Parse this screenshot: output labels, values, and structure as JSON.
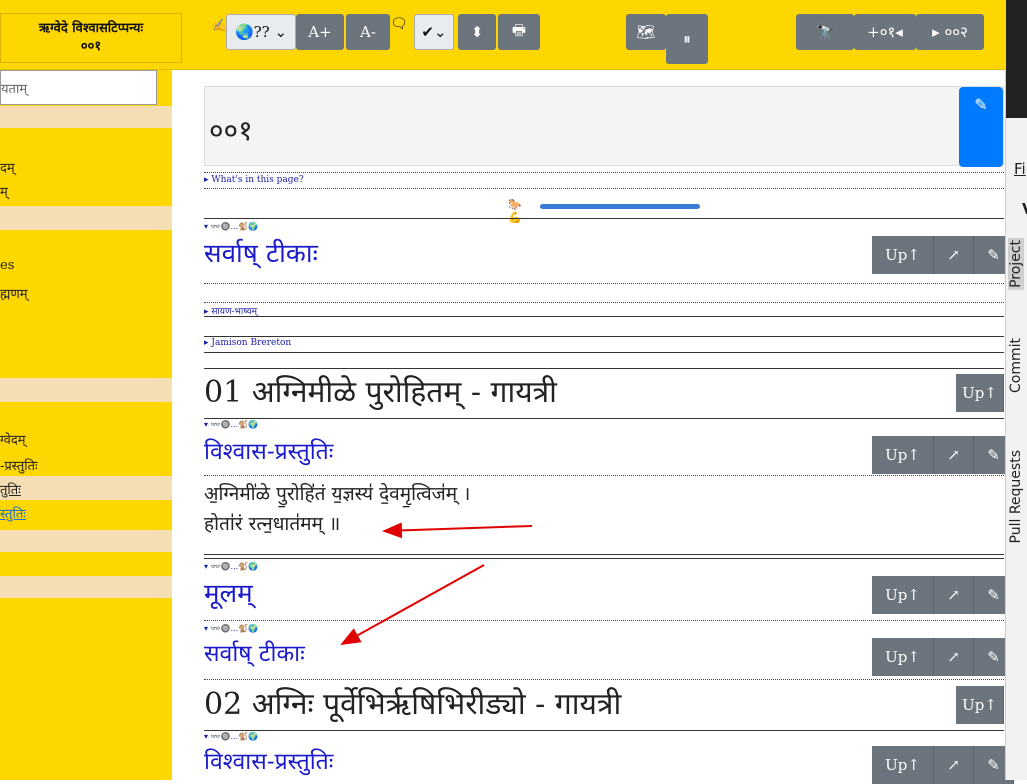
{
  "topbar": {
    "book_title_line1": "ऋग्वेदे विश्वासटिप्पन्यः",
    "book_title_line2": "००१",
    "language_select": "🌏??",
    "font_increase": "A+",
    "font_decrease": "A-",
    "check_select": "✔",
    "updown_icon": "⬍",
    "print_icon": "🖶",
    "map_icon": "🗺",
    "pause_icon": "⏸",
    "tools_icon": "🔭",
    "next_label": "+०१◂",
    "page_next": "▸ ००२"
  },
  "sidebar": {
    "search_placeholder": "यताम्",
    "items": [
      {
        "label": "दम्"
      },
      {
        "label": "म्"
      },
      {
        "label": "es"
      },
      {
        "label": "ह्मणम्"
      },
      {
        "label": "ग्वेदम्"
      },
      {
        "label": "-प्रस्तुतिः"
      },
      {
        "label": "तुतिः"
      },
      {
        "label": "स्तुतिः"
      }
    ]
  },
  "page": {
    "number": "००१",
    "whats_in_page": "▸ What's in this page?",
    "sections": [
      {
        "mini": "▾ 👓🔘...🐒🌍",
        "title": "सर्वाष् टीकाः"
      },
      {
        "link": "▸ सायण-भाष्यम्"
      },
      {
        "link": "▸ Jamison Brereton"
      }
    ],
    "verse1_heading": "01 अग्निमीळे पुरोहितम् - गायत्री",
    "verse1_sub": "विश्वास-प्रस्तुतिः",
    "verse1_line1": "अ॒ग्निमी॑ळे पु॒रोहि॑तं य॒ज्ञस्य॑ दे॒वमृ॒त्विज॑म् ।",
    "verse1_line2": "होता॑रं रत्न॒धात॑मम् ॥",
    "mulam": "मूलम्",
    "sarva2": "सर्वाष् टीकाः",
    "verse2_heading": "02 अग्निः पूर्वेभिर्ऋषिभिरीड्यो - गायत्री",
    "verse2_sub": "विश्वास-प्रस्तुतिः",
    "mini_icons": "▾ 👓🔘...🐒🌍",
    "up_label": "Up↑",
    "open_icon": "↗",
    "edit_icon": "✎",
    "progress_emoji": "🐎💪"
  },
  "right_panel": {
    "fi": "Fi",
    "v": "V",
    "tab_project": "Project",
    "tab_commit": "Commit",
    "tab_pull": "Pull Requests"
  },
  "colors": {
    "yellow": "#FFD700",
    "wheat": "#F5DEB3",
    "blue": "#007bff",
    "grey_btn": "#6c757d",
    "arrow_red": "#e00000"
  }
}
